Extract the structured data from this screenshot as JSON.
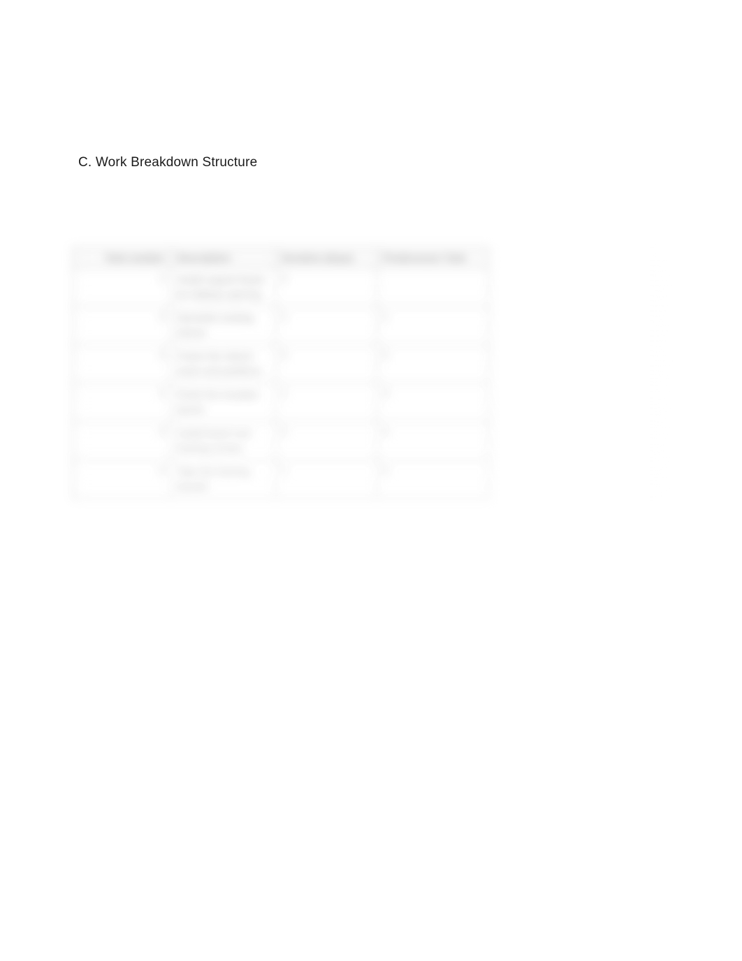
{
  "section": {
    "title": "C. Work Breakdown Structure"
  },
  "table": {
    "headers": {
      "task_number": "Task number",
      "description": "Description",
      "duration": "Duration (days)",
      "predecessor": "Predecessor Task"
    },
    "rows": [
      {
        "num": "1",
        "desc": "Install support beam for hallway opening",
        "dur": "2",
        "pred": ""
      },
      {
        "num": "2",
        "desc": "Demolish existing interior",
        "dur": "1",
        "pred": "1"
      },
      {
        "num": "3",
        "desc": "Frame the interior studs and partitions",
        "dur": "2",
        "pred": "2"
      },
      {
        "num": "4",
        "desc": "Finish the insulator barrier",
        "dur": "1",
        "pred": "3"
      },
      {
        "num": "5",
        "desc": "Install board over framing screws",
        "dur": "2",
        "pred": "4"
      },
      {
        "num": "6",
        "desc": "Tape the framing drywall",
        "dur": "1",
        "pred": "5"
      }
    ]
  }
}
